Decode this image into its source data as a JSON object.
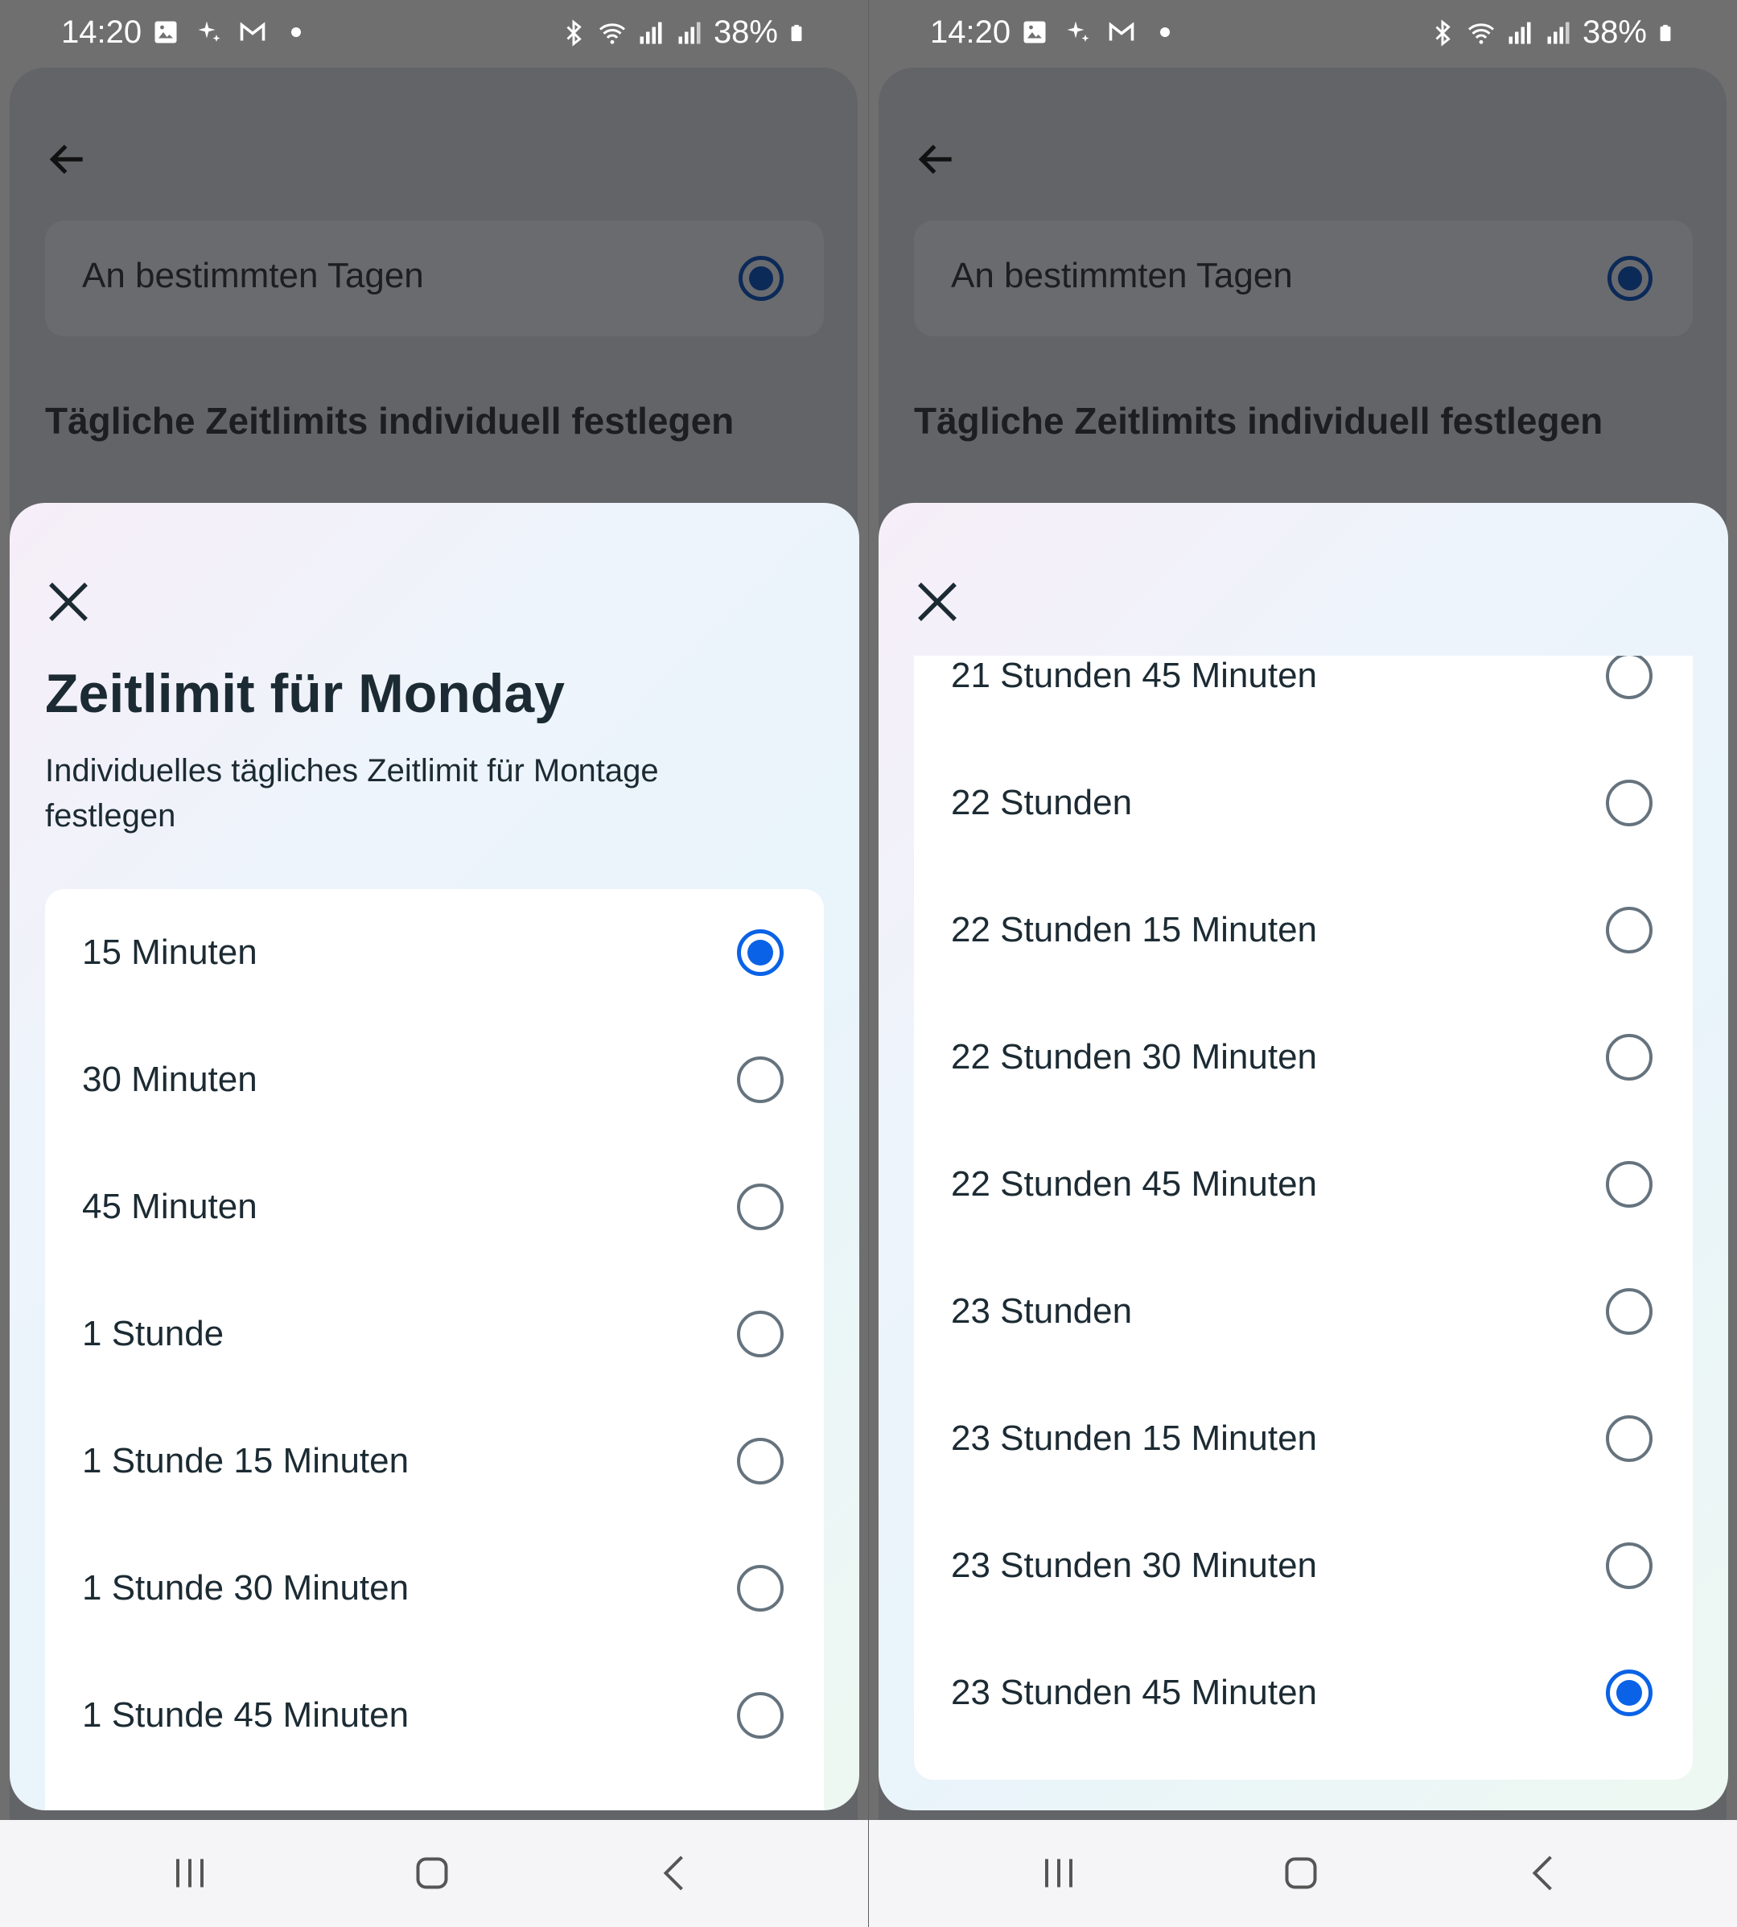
{
  "status_bar": {
    "time": "14:20",
    "battery": "38%"
  },
  "background_screen": {
    "option_label": "An bestimmten Tagen",
    "section_heading": "Tägliche Zeitlimits individuell festlegen"
  },
  "left_sheet": {
    "title": "Zeitlimit für Monday",
    "subtitle": "Individuelles tägliches Zeitlimit für Montage festlegen",
    "options": [
      {
        "label": "15 Minuten",
        "selected": true
      },
      {
        "label": "30 Minuten",
        "selected": false
      },
      {
        "label": "45 Minuten",
        "selected": false
      },
      {
        "label": "1 Stunde",
        "selected": false
      },
      {
        "label": "1 Stunde 15 Minuten",
        "selected": false
      },
      {
        "label": "1 Stunde 30 Minuten",
        "selected": false
      },
      {
        "label": "1 Stunde 45 Minuten",
        "selected": false
      }
    ]
  },
  "right_sheet": {
    "options": [
      {
        "label": "21 Stunden 45 Minuten",
        "selected": false
      },
      {
        "label": "22 Stunden",
        "selected": false
      },
      {
        "label": "22 Stunden 15 Minuten",
        "selected": false
      },
      {
        "label": "22 Stunden 30 Minuten",
        "selected": false
      },
      {
        "label": "22 Stunden 45 Minuten",
        "selected": false
      },
      {
        "label": "23 Stunden",
        "selected": false
      },
      {
        "label": "23 Stunden 15 Minuten",
        "selected": false
      },
      {
        "label": "23 Stunden 30 Minuten",
        "selected": false
      },
      {
        "label": "23 Stunden 45 Minuten",
        "selected": true
      }
    ]
  },
  "colors": {
    "accent": "#0a62e6",
    "text": "#1c2b33",
    "scrim": "#6f6f6f"
  },
  "icons": {
    "back": "arrow-left-icon",
    "close": "close-icon",
    "nav_recents": "recents-icon",
    "nav_home": "home-icon",
    "nav_back": "back-icon"
  }
}
